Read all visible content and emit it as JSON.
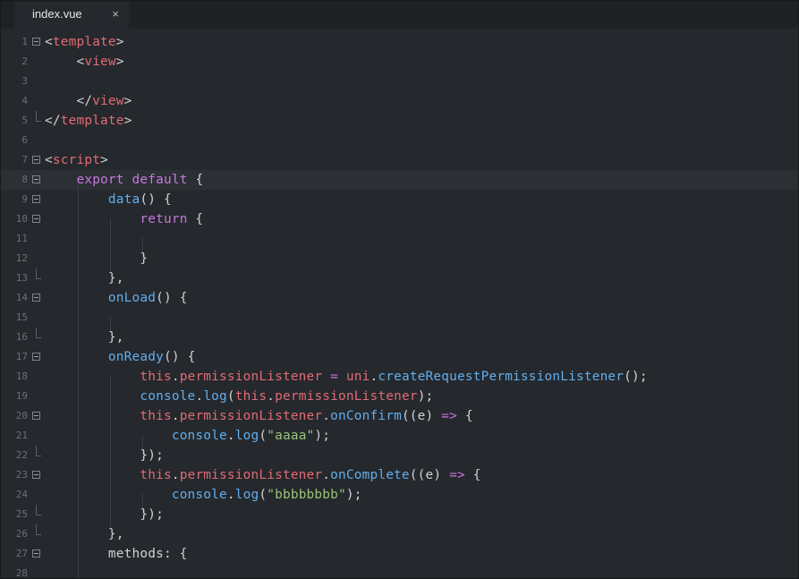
{
  "tab": {
    "title": "index.vue",
    "close_glyph": "×"
  },
  "editor": {
    "active_line": 8,
    "lines": [
      {
        "n": "1",
        "fold": "open",
        "tokens": [
          {
            "c": "p",
            "t": "<"
          },
          {
            "c": "t",
            "t": "template"
          },
          {
            "c": "p",
            "t": ">"
          }
        ]
      },
      {
        "n": "2",
        "tokens": [
          {
            "c": "p",
            "t": "    <"
          },
          {
            "c": "t",
            "t": "view"
          },
          {
            "c": "p",
            "t": ">"
          }
        ]
      },
      {
        "n": "3",
        "tokens": []
      },
      {
        "n": "4",
        "tokens": [
          {
            "c": "p",
            "t": "    </"
          },
          {
            "c": "t",
            "t": "view"
          },
          {
            "c": "p",
            "t": ">"
          }
        ]
      },
      {
        "n": "5",
        "fold": "end",
        "tokens": [
          {
            "c": "p",
            "t": "</"
          },
          {
            "c": "t",
            "t": "template"
          },
          {
            "c": "p",
            "t": ">"
          }
        ]
      },
      {
        "n": "6",
        "tokens": []
      },
      {
        "n": "7",
        "fold": "open",
        "tokens": [
          {
            "c": "p",
            "t": "<"
          },
          {
            "c": "t",
            "t": "script"
          },
          {
            "c": "p",
            "t": ">"
          }
        ]
      },
      {
        "n": "8",
        "fold": "open",
        "tokens": [
          {
            "c": "p",
            "t": "    "
          },
          {
            "c": "k",
            "t": "export"
          },
          {
            "c": "p",
            "t": " "
          },
          {
            "c": "k",
            "t": "default"
          },
          {
            "c": "p",
            "t": " {"
          }
        ]
      },
      {
        "n": "9",
        "fold": "open",
        "tokens": [
          {
            "c": "p",
            "t": "        "
          },
          {
            "c": "f",
            "t": "data"
          },
          {
            "c": "p",
            "t": "() {"
          }
        ]
      },
      {
        "n": "10",
        "fold": "open",
        "tokens": [
          {
            "c": "p",
            "t": "            "
          },
          {
            "c": "k",
            "t": "return"
          },
          {
            "c": "p",
            "t": " {"
          }
        ]
      },
      {
        "n": "11",
        "tokens": []
      },
      {
        "n": "12",
        "tokens": [
          {
            "c": "p",
            "t": "            }"
          }
        ]
      },
      {
        "n": "13",
        "fold": "end",
        "tokens": [
          {
            "c": "p",
            "t": "        },"
          }
        ]
      },
      {
        "n": "14",
        "fold": "open",
        "tokens": [
          {
            "c": "p",
            "t": "        "
          },
          {
            "c": "f",
            "t": "onLoad"
          },
          {
            "c": "p",
            "t": "() {"
          }
        ]
      },
      {
        "n": "15",
        "tokens": []
      },
      {
        "n": "16",
        "fold": "end",
        "tokens": [
          {
            "c": "p",
            "t": "        },"
          }
        ]
      },
      {
        "n": "17",
        "fold": "open",
        "tokens": [
          {
            "c": "p",
            "t": "        "
          },
          {
            "c": "f",
            "t": "onReady"
          },
          {
            "c": "p",
            "t": "() {"
          }
        ]
      },
      {
        "n": "18",
        "tokens": [
          {
            "c": "p",
            "t": "            "
          },
          {
            "c": "t",
            "t": "this"
          },
          {
            "c": "p",
            "t": "."
          },
          {
            "c": "t",
            "t": "permissionListener"
          },
          {
            "c": "p",
            "t": " "
          },
          {
            "c": "k",
            "t": "="
          },
          {
            "c": "p",
            "t": " "
          },
          {
            "c": "t",
            "t": "uni"
          },
          {
            "c": "p",
            "t": "."
          },
          {
            "c": "f",
            "t": "createRequestPermissionListener"
          },
          {
            "c": "p",
            "t": "();"
          }
        ]
      },
      {
        "n": "19",
        "tokens": [
          {
            "c": "p",
            "t": "            "
          },
          {
            "c": "f",
            "t": "console"
          },
          {
            "c": "p",
            "t": "."
          },
          {
            "c": "f",
            "t": "log"
          },
          {
            "c": "p",
            "t": "("
          },
          {
            "c": "t",
            "t": "this"
          },
          {
            "c": "p",
            "t": "."
          },
          {
            "c": "t",
            "t": "permissionListener"
          },
          {
            "c": "p",
            "t": ");"
          }
        ]
      },
      {
        "n": "20",
        "fold": "open",
        "tokens": [
          {
            "c": "p",
            "t": "            "
          },
          {
            "c": "t",
            "t": "this"
          },
          {
            "c": "p",
            "t": "."
          },
          {
            "c": "t",
            "t": "permissionListener"
          },
          {
            "c": "p",
            "t": "."
          },
          {
            "c": "f",
            "t": "onConfirm"
          },
          {
            "c": "p",
            "t": "((e) "
          },
          {
            "c": "k",
            "t": "=>"
          },
          {
            "c": "p",
            "t": " {"
          }
        ]
      },
      {
        "n": "21",
        "tokens": [
          {
            "c": "p",
            "t": "                "
          },
          {
            "c": "f",
            "t": "console"
          },
          {
            "c": "p",
            "t": "."
          },
          {
            "c": "f",
            "t": "log"
          },
          {
            "c": "p",
            "t": "("
          },
          {
            "c": "s",
            "t": "\"aaaa\""
          },
          {
            "c": "p",
            "t": ");"
          }
        ]
      },
      {
        "n": "22",
        "fold": "end",
        "tokens": [
          {
            "c": "p",
            "t": "            });"
          }
        ]
      },
      {
        "n": "23",
        "fold": "open",
        "tokens": [
          {
            "c": "p",
            "t": "            "
          },
          {
            "c": "t",
            "t": "this"
          },
          {
            "c": "p",
            "t": "."
          },
          {
            "c": "t",
            "t": "permissionListener"
          },
          {
            "c": "p",
            "t": "."
          },
          {
            "c": "f",
            "t": "onComplete"
          },
          {
            "c": "p",
            "t": "((e) "
          },
          {
            "c": "k",
            "t": "=>"
          },
          {
            "c": "p",
            "t": " {"
          }
        ]
      },
      {
        "n": "24",
        "tokens": [
          {
            "c": "p",
            "t": "                "
          },
          {
            "c": "f",
            "t": "console"
          },
          {
            "c": "p",
            "t": "."
          },
          {
            "c": "f",
            "t": "log"
          },
          {
            "c": "p",
            "t": "("
          },
          {
            "c": "s",
            "t": "\"bbbbbbbb\""
          },
          {
            "c": "p",
            "t": ");"
          }
        ]
      },
      {
        "n": "25",
        "fold": "end",
        "tokens": [
          {
            "c": "p",
            "t": "            });"
          }
        ]
      },
      {
        "n": "26",
        "fold": "end",
        "tokens": [
          {
            "c": "p",
            "t": "        },"
          }
        ]
      },
      {
        "n": "27",
        "fold": "open",
        "tokens": [
          {
            "c": "p",
            "t": "        methods: {"
          }
        ]
      },
      {
        "n": "28",
        "tokens": []
      }
    ]
  },
  "colors": {
    "background": "#25282c",
    "tag": "#e06c75",
    "keyword": "#c678dd",
    "function": "#61afef",
    "string": "#98c379",
    "plain": "#cfd2d6"
  }
}
